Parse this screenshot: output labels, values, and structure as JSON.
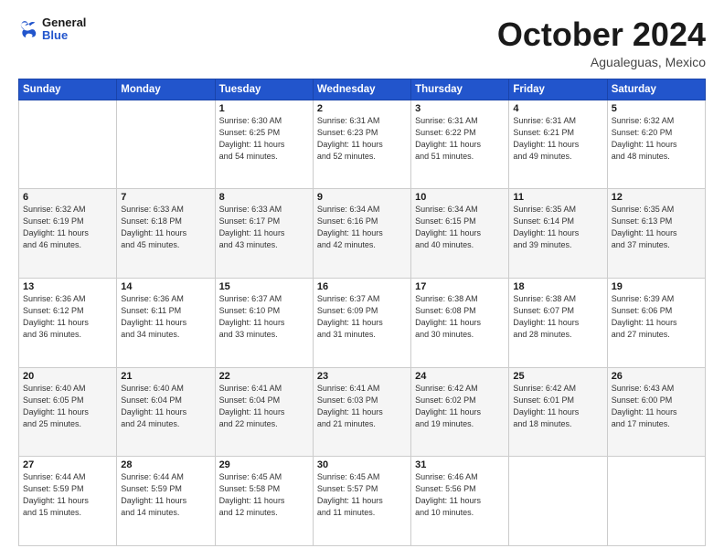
{
  "header": {
    "logo": {
      "general": "General",
      "blue": "Blue"
    },
    "title": "October 2024",
    "subtitle": "Agualeguas, Mexico"
  },
  "weekdays": [
    "Sunday",
    "Monday",
    "Tuesday",
    "Wednesday",
    "Thursday",
    "Friday",
    "Saturday"
  ],
  "weeks": [
    [
      {
        "day": "",
        "info": ""
      },
      {
        "day": "",
        "info": ""
      },
      {
        "day": "1",
        "info": "Sunrise: 6:30 AM\nSunset: 6:25 PM\nDaylight: 11 hours\nand 54 minutes."
      },
      {
        "day": "2",
        "info": "Sunrise: 6:31 AM\nSunset: 6:23 PM\nDaylight: 11 hours\nand 52 minutes."
      },
      {
        "day": "3",
        "info": "Sunrise: 6:31 AM\nSunset: 6:22 PM\nDaylight: 11 hours\nand 51 minutes."
      },
      {
        "day": "4",
        "info": "Sunrise: 6:31 AM\nSunset: 6:21 PM\nDaylight: 11 hours\nand 49 minutes."
      },
      {
        "day": "5",
        "info": "Sunrise: 6:32 AM\nSunset: 6:20 PM\nDaylight: 11 hours\nand 48 minutes."
      }
    ],
    [
      {
        "day": "6",
        "info": "Sunrise: 6:32 AM\nSunset: 6:19 PM\nDaylight: 11 hours\nand 46 minutes."
      },
      {
        "day": "7",
        "info": "Sunrise: 6:33 AM\nSunset: 6:18 PM\nDaylight: 11 hours\nand 45 minutes."
      },
      {
        "day": "8",
        "info": "Sunrise: 6:33 AM\nSunset: 6:17 PM\nDaylight: 11 hours\nand 43 minutes."
      },
      {
        "day": "9",
        "info": "Sunrise: 6:34 AM\nSunset: 6:16 PM\nDaylight: 11 hours\nand 42 minutes."
      },
      {
        "day": "10",
        "info": "Sunrise: 6:34 AM\nSunset: 6:15 PM\nDaylight: 11 hours\nand 40 minutes."
      },
      {
        "day": "11",
        "info": "Sunrise: 6:35 AM\nSunset: 6:14 PM\nDaylight: 11 hours\nand 39 minutes."
      },
      {
        "day": "12",
        "info": "Sunrise: 6:35 AM\nSunset: 6:13 PM\nDaylight: 11 hours\nand 37 minutes."
      }
    ],
    [
      {
        "day": "13",
        "info": "Sunrise: 6:36 AM\nSunset: 6:12 PM\nDaylight: 11 hours\nand 36 minutes."
      },
      {
        "day": "14",
        "info": "Sunrise: 6:36 AM\nSunset: 6:11 PM\nDaylight: 11 hours\nand 34 minutes."
      },
      {
        "day": "15",
        "info": "Sunrise: 6:37 AM\nSunset: 6:10 PM\nDaylight: 11 hours\nand 33 minutes."
      },
      {
        "day": "16",
        "info": "Sunrise: 6:37 AM\nSunset: 6:09 PM\nDaylight: 11 hours\nand 31 minutes."
      },
      {
        "day": "17",
        "info": "Sunrise: 6:38 AM\nSunset: 6:08 PM\nDaylight: 11 hours\nand 30 minutes."
      },
      {
        "day": "18",
        "info": "Sunrise: 6:38 AM\nSunset: 6:07 PM\nDaylight: 11 hours\nand 28 minutes."
      },
      {
        "day": "19",
        "info": "Sunrise: 6:39 AM\nSunset: 6:06 PM\nDaylight: 11 hours\nand 27 minutes."
      }
    ],
    [
      {
        "day": "20",
        "info": "Sunrise: 6:40 AM\nSunset: 6:05 PM\nDaylight: 11 hours\nand 25 minutes."
      },
      {
        "day": "21",
        "info": "Sunrise: 6:40 AM\nSunset: 6:04 PM\nDaylight: 11 hours\nand 24 minutes."
      },
      {
        "day": "22",
        "info": "Sunrise: 6:41 AM\nSunset: 6:04 PM\nDaylight: 11 hours\nand 22 minutes."
      },
      {
        "day": "23",
        "info": "Sunrise: 6:41 AM\nSunset: 6:03 PM\nDaylight: 11 hours\nand 21 minutes."
      },
      {
        "day": "24",
        "info": "Sunrise: 6:42 AM\nSunset: 6:02 PM\nDaylight: 11 hours\nand 19 minutes."
      },
      {
        "day": "25",
        "info": "Sunrise: 6:42 AM\nSunset: 6:01 PM\nDaylight: 11 hours\nand 18 minutes."
      },
      {
        "day": "26",
        "info": "Sunrise: 6:43 AM\nSunset: 6:00 PM\nDaylight: 11 hours\nand 17 minutes."
      }
    ],
    [
      {
        "day": "27",
        "info": "Sunrise: 6:44 AM\nSunset: 5:59 PM\nDaylight: 11 hours\nand 15 minutes."
      },
      {
        "day": "28",
        "info": "Sunrise: 6:44 AM\nSunset: 5:59 PM\nDaylight: 11 hours\nand 14 minutes."
      },
      {
        "day": "29",
        "info": "Sunrise: 6:45 AM\nSunset: 5:58 PM\nDaylight: 11 hours\nand 12 minutes."
      },
      {
        "day": "30",
        "info": "Sunrise: 6:45 AM\nSunset: 5:57 PM\nDaylight: 11 hours\nand 11 minutes."
      },
      {
        "day": "31",
        "info": "Sunrise: 6:46 AM\nSunset: 5:56 PM\nDaylight: 11 hours\nand 10 minutes."
      },
      {
        "day": "",
        "info": ""
      },
      {
        "day": "",
        "info": ""
      }
    ]
  ]
}
